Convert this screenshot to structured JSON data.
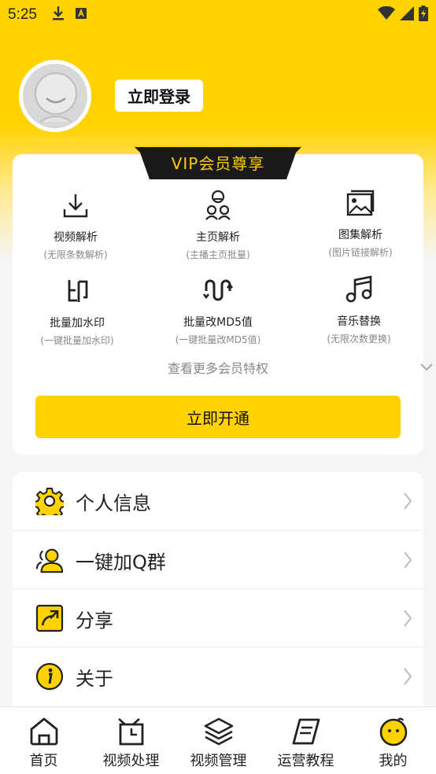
{
  "status_bar": {
    "time": "5:25",
    "icons": [
      "download-icon",
      "font-a-icon",
      "wifi-icon",
      "signal-icon",
      "battery-charging-icon"
    ]
  },
  "profile": {
    "avatar": "default-avatar",
    "login_label": "立即登录"
  },
  "vip": {
    "banner_title": "VIP会员尊享",
    "features": [
      {
        "name": "视频解析",
        "desc": "(无限条数解析)",
        "icon": "download-icon"
      },
      {
        "name": "主页解析",
        "desc": "(主播主页批量)",
        "icon": "users-icon"
      },
      {
        "name": "图集解析",
        "desc": "(图片链接解析)",
        "icon": "gallery-icon"
      },
      {
        "name": "批量加水印",
        "desc": "(一键批量加水印)",
        "icon": "stamp-icon"
      },
      {
        "name": "批量改MD5值",
        "desc": "(一键批量改MD5值)",
        "icon": "wave-icon"
      },
      {
        "name": "音乐替换",
        "desc": "(无限次数更换)",
        "icon": "music-icon"
      }
    ],
    "more_label": "查看更多会员特权",
    "open_label": "立即开通"
  },
  "menu": [
    {
      "label": "个人信息",
      "icon": "gear-icon"
    },
    {
      "label": "一键加Q群",
      "icon": "user-group-icon"
    },
    {
      "label": "分享",
      "icon": "share-icon"
    },
    {
      "label": "关于",
      "icon": "info-icon"
    }
  ],
  "bottom_nav": [
    {
      "label": "首页",
      "icon": "home-icon"
    },
    {
      "label": "视频处理",
      "icon": "video-process-icon"
    },
    {
      "label": "视频管理",
      "icon": "layers-icon"
    },
    {
      "label": "运营教程",
      "icon": "notebook-icon"
    },
    {
      "label": "我的",
      "icon": "smiley-icon",
      "active": true
    }
  ],
  "colors": {
    "accent": "#ffd200",
    "banner_bg": "#1a1a1a",
    "banner_text": "#ffcc00",
    "muted_text": "#888888"
  }
}
